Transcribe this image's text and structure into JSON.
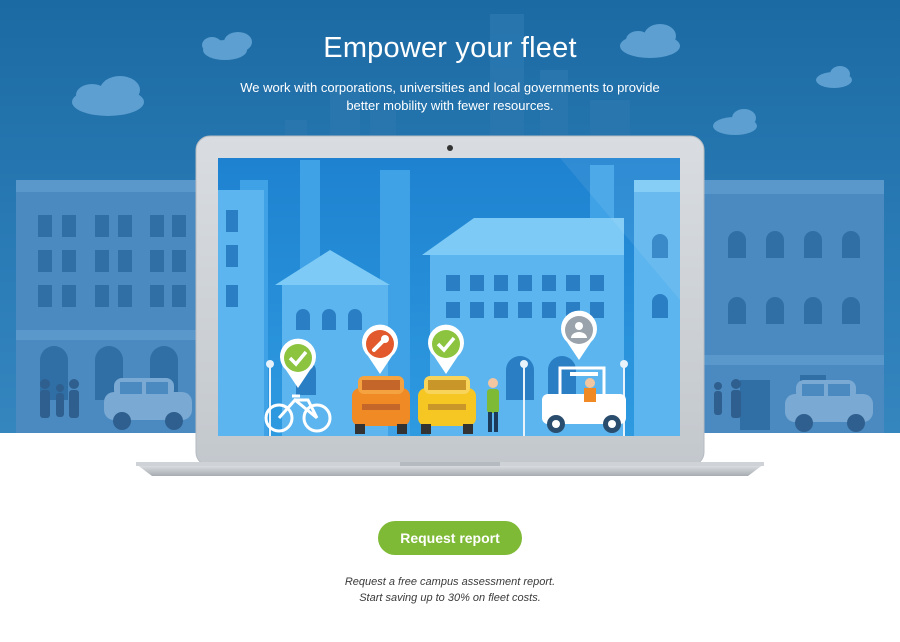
{
  "hero": {
    "title": "Empower your fleet",
    "subtitle_line1": "We work with corporations, universities and local governments to provide",
    "subtitle_line2": "better mobility with fewer resources."
  },
  "cta": {
    "label": "Request report"
  },
  "note": {
    "line1": "Request a free campus assessment report.",
    "line2": "Start saving up to 30% on fleet costs."
  },
  "colors": {
    "sky": "#1c6aa3",
    "accent_green": "#7fba36",
    "pin_orange": "#e2592d",
    "car_orange": "#f08a24",
    "car_yellow": "#f6c623"
  },
  "icons": [
    "cloud-icon",
    "check-pin-icon",
    "wrench-pin-icon",
    "user-pin-icon",
    "bicycle-icon",
    "car-icon",
    "cart-icon",
    "webcam-icon"
  ]
}
